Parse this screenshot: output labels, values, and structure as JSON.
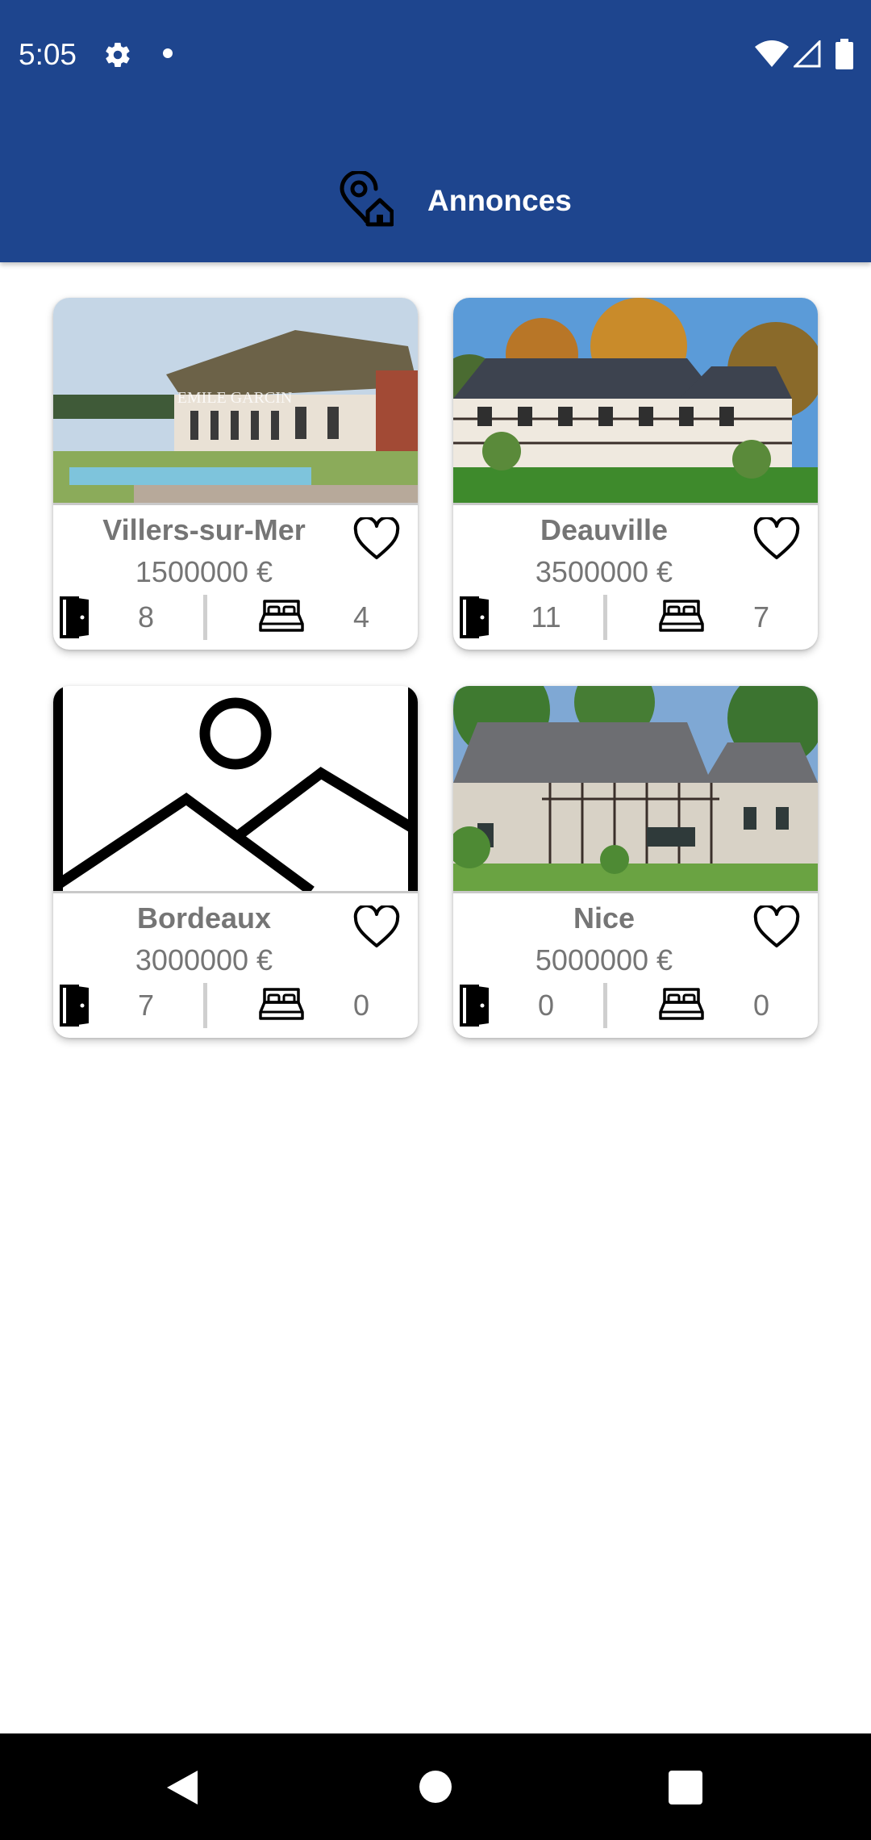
{
  "status_bar": {
    "time": "5:05",
    "icons": [
      "gear-icon",
      "notification-dot",
      "wifi-icon",
      "signal-icon",
      "battery-icon"
    ]
  },
  "toolbar": {
    "title": "Annonces",
    "icon": "location-home-icon"
  },
  "colors": {
    "primary": "#1e458e",
    "text_muted": "#757575",
    "background": "#ffffff"
  },
  "listings": [
    {
      "city": "Villers-sur-Mer",
      "price": "1500000 €",
      "rooms": "8",
      "beds": "4",
      "image": "thatched-house-photo",
      "watermark": "EMILE GARCIN"
    },
    {
      "city": "Deauville",
      "price": "3500000 €",
      "rooms": "11",
      "beds": "7",
      "image": "timbered-house-photo"
    },
    {
      "city": "Bordeaux",
      "price": "3000000 €",
      "rooms": "7",
      "beds": "0",
      "image": "image-placeholder-icon"
    },
    {
      "city": "Nice",
      "price": "5000000 €",
      "rooms": "0",
      "beds": "0",
      "image": "manor-house-photo"
    }
  ],
  "nav_bar": {
    "buttons": [
      "back-button",
      "home-button",
      "recents-button"
    ]
  }
}
